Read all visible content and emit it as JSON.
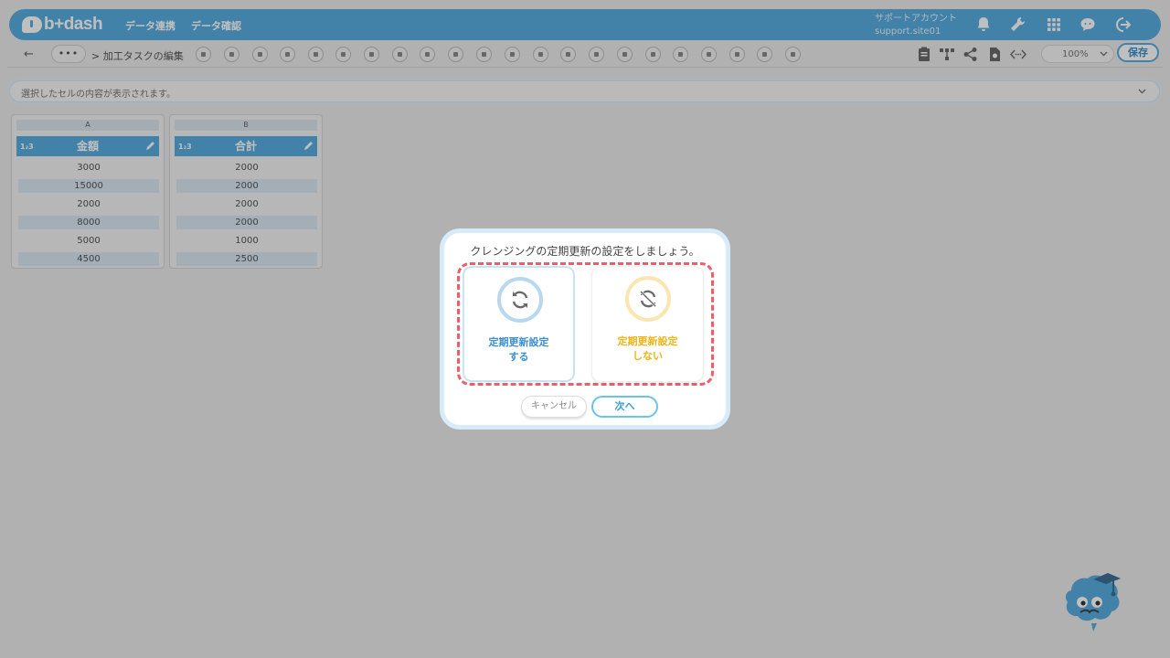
{
  "header": {
    "logo_text": "b+dash",
    "nav": [
      "データ連携",
      "データ確認"
    ],
    "account_label": "サポートアカウント",
    "account_id": "support.site01"
  },
  "toolbar": {
    "breadcrumb": "> 加工タスクの編集",
    "more_label": "•••",
    "zoom": "100%",
    "save_label": "保存"
  },
  "cellbar": {
    "placeholder": "選択したセルの内容が表示されます。"
  },
  "columns": [
    {
      "letter": "A",
      "type": "1₂3",
      "name": "金額",
      "values": [
        "3000",
        "15000",
        "2000",
        "8000",
        "5000",
        "4500"
      ]
    },
    {
      "letter": "B",
      "type": "1₂3",
      "name": "合計",
      "values": [
        "2000",
        "2000",
        "2000",
        "2000",
        "1000",
        "2500"
      ]
    }
  ],
  "modal": {
    "title": "クレンジングの定期更新の設定をしましょう。",
    "option_yes": {
      "line1": "定期更新設定",
      "line2": "する",
      "color": "#3b8fd0"
    },
    "option_no": {
      "line1": "定期更新設定",
      "line2": "しない",
      "color": "#f0b419"
    },
    "cancel_label": "キャンセル",
    "next_label": "次へ"
  },
  "colors": {
    "brand": "#5aaee0",
    "highlight": "#e86069"
  }
}
